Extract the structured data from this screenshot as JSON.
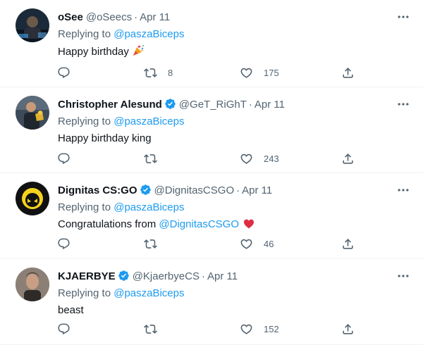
{
  "tweets": [
    {
      "name": "oSee",
      "handle": "@oSeecs",
      "separator": "·",
      "date": "Apr 11",
      "replying_prefix": "Replying to ",
      "replying_to": "@paszaBiceps",
      "text": "Happy birthday",
      "emoji": "party-popper-icon",
      "reply_count": "",
      "retweet_count": "8",
      "like_count": "175"
    },
    {
      "name": "Christopher Alesund",
      "handle": "@GeT_RiGhT",
      "separator": "·",
      "date": "Apr 11",
      "replying_prefix": "Replying to ",
      "replying_to": "@paszaBiceps",
      "text": "Happy birthday king",
      "reply_count": "",
      "retweet_count": "",
      "like_count": "243"
    },
    {
      "name": "Dignitas CS:GO",
      "handle": "@DignitasCSGO",
      "separator": "·",
      "date": "Apr 11",
      "replying_prefix": "Replying to ",
      "replying_to": "@paszaBiceps",
      "text": "Congratulations from ",
      "text_mention": "@DignitasCSGO",
      "emoji": "red-heart-icon",
      "reply_count": "",
      "retweet_count": "",
      "like_count": "46"
    },
    {
      "name": "KJAERBYE",
      "handle": "@KjaerbyeCS",
      "separator": "·",
      "date": "Apr 11",
      "replying_prefix": "Replying to ",
      "replying_to": "@paszaBiceps",
      "text": "beast",
      "reply_count": "",
      "retweet_count": "",
      "like_count": "152"
    }
  ],
  "colors": {
    "text": "#0f1419",
    "secondary": "#536471",
    "link": "#1d9bf0",
    "verified": "#1d9bf0",
    "heart": "#e0245e",
    "divider": "#eff3f4"
  }
}
